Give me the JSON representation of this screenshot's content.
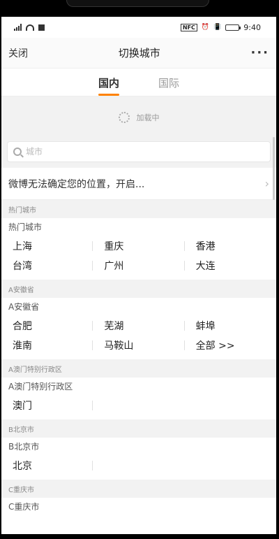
{
  "status": {
    "time": "9:40",
    "nfc": "NFC",
    "alarm": "⏰",
    "vibrate": "📳"
  },
  "nav": {
    "close": "关闭",
    "title": "切换城市",
    "more": "···"
  },
  "tabs": [
    {
      "label": "国内",
      "active": true
    },
    {
      "label": "国际",
      "active": false
    }
  ],
  "loading": {
    "text": "加载中"
  },
  "search": {
    "placeholder": "城市"
  },
  "location": {
    "text": "微博无法确定您的位置，开启...",
    "arrow": "›"
  },
  "sections": [
    {
      "header": "热门城市",
      "sub": "热门城市",
      "cities": [
        "上海",
        "重庆",
        "香港",
        "台湾",
        "广州",
        "大连"
      ]
    },
    {
      "header": "A安徽省",
      "sub": "A安徽省",
      "cities": [
        "合肥",
        "芜湖",
        "蚌埠",
        "淮南",
        "马鞍山",
        "全部 >>"
      ]
    },
    {
      "header": "A澳门特别行政区",
      "sub": "A澳门特别行政区",
      "cities": [
        "澳门"
      ]
    },
    {
      "header": "B北京市",
      "sub": "B北京市",
      "cities": [
        "北京"
      ]
    },
    {
      "header": "C重庆市",
      "sub": "C重庆市",
      "cities": []
    }
  ]
}
